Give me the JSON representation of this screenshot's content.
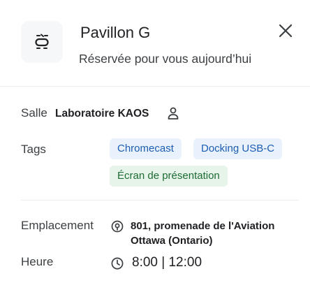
{
  "header": {
    "icon": "meeting-room-icon",
    "title": "Pavillon G",
    "subtitle": "Réservée pour vous aujourd’hui",
    "close_icon": "close-icon"
  },
  "room": {
    "label": "Salle",
    "name": "Laboratoire KAOS",
    "capacity_icon": "person-icon"
  },
  "tags": {
    "label": "Tags",
    "items": [
      {
        "label": "Chromecast",
        "color": "#1d5db3",
        "background": "#e8f1fc"
      },
      {
        "label": "Docking USB-C",
        "color": "#1d5db3",
        "background": "#e8f1fc"
      },
      {
        "label": "Écran de présentation",
        "color": "#1e6b35",
        "background": "#e6f4ea"
      }
    ]
  },
  "location": {
    "label": "Emplacement",
    "icon": "location-pin-icon",
    "address_line1": "801, promenade de l'Aviation",
    "address_line2": "Ottawa (Ontario)"
  },
  "time": {
    "label": "Heure",
    "icon": "clock-icon",
    "value": "8:00 | 12:00"
  }
}
